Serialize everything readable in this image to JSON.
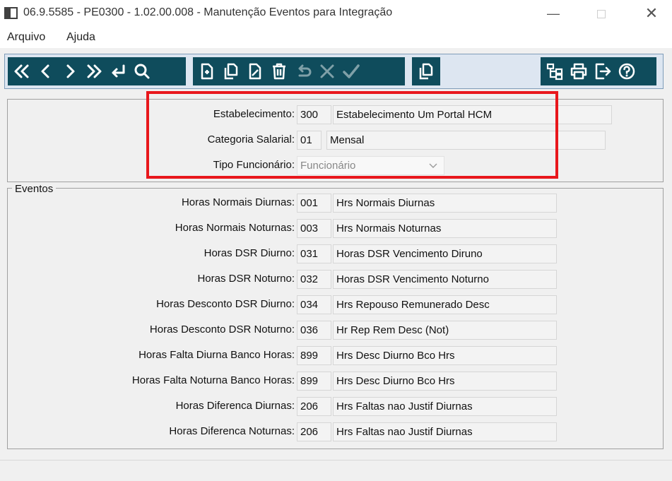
{
  "window": {
    "title": "06.9.5585 - PE0300 - 1.02.00.008 - Manutenção Eventos para Integração",
    "icon": "program-window-icon",
    "minimize_glyph": "—",
    "close_glyph": "✕"
  },
  "menu": [
    {
      "label": "Arquivo"
    },
    {
      "label": "Ajuda"
    }
  ],
  "toolbar": {
    "accent": "#0f4c5c",
    "navigation": [
      "first-record-icon",
      "previous-record-icon",
      "next-record-icon",
      "last-record-icon",
      "goto-icon",
      "search-icon"
    ],
    "editing": [
      "new-record-icon",
      "copy-record-icon",
      "edit-record-icon",
      "delete-record-icon",
      "undo-icon",
      "cancel-icon",
      "save-check-icon"
    ],
    "extra": [
      "duplicate-icon"
    ],
    "tools": [
      "structure-icon",
      "print-icon",
      "exit-icon",
      "help-icon"
    ]
  },
  "header": {
    "establishment": {
      "label": "Estabelecimento:",
      "code": "300",
      "description": "Estabelecimento Um Portal HCM"
    },
    "salary_category": {
      "label": "Categoria Salarial:",
      "code": "01",
      "description": "Mensal"
    },
    "employee_type": {
      "label": "Tipo Funcionário:",
      "value": "Funcionário"
    },
    "highlight_color": "#e8171c"
  },
  "events": {
    "legend": "Eventos",
    "rows": [
      {
        "label": "Horas Normais Diurnas:",
        "code": "001",
        "description": "Hrs Normais Diurnas"
      },
      {
        "label": "Horas Normais Noturnas:",
        "code": "003",
        "description": "Hrs Normais Noturnas"
      },
      {
        "label": "Horas DSR Diurno:",
        "code": "031",
        "description": "Horas DSR Vencimento Diruno"
      },
      {
        "label": "Horas DSR Noturno:",
        "code": "032",
        "description": "Horas DSR Vencimento Noturno"
      },
      {
        "label": "Horas Desconto DSR Diurno:",
        "code": "034",
        "description": "Hrs Repouso Remunerado Desc"
      },
      {
        "label": "Horas Desconto DSR Noturno:",
        "code": "036",
        "description": "Hr Rep Rem Desc (Not)"
      },
      {
        "label": "Horas Falta Diurna Banco Horas:",
        "code": "899",
        "description": "Hrs Desc Diurno Bco Hrs"
      },
      {
        "label": "Horas Falta Noturna Banco Horas:",
        "code": "899",
        "description": "Hrs Desc Diurno Bco Hrs"
      },
      {
        "label": "Horas Diferenca Diurnas:",
        "code": "206",
        "description": "Hrs Faltas nao Justif Diurnas"
      },
      {
        "label": "Horas Diferenca Noturnas:",
        "code": "206",
        "description": "Hrs Faltas nao Justif Diurnas"
      }
    ]
  }
}
